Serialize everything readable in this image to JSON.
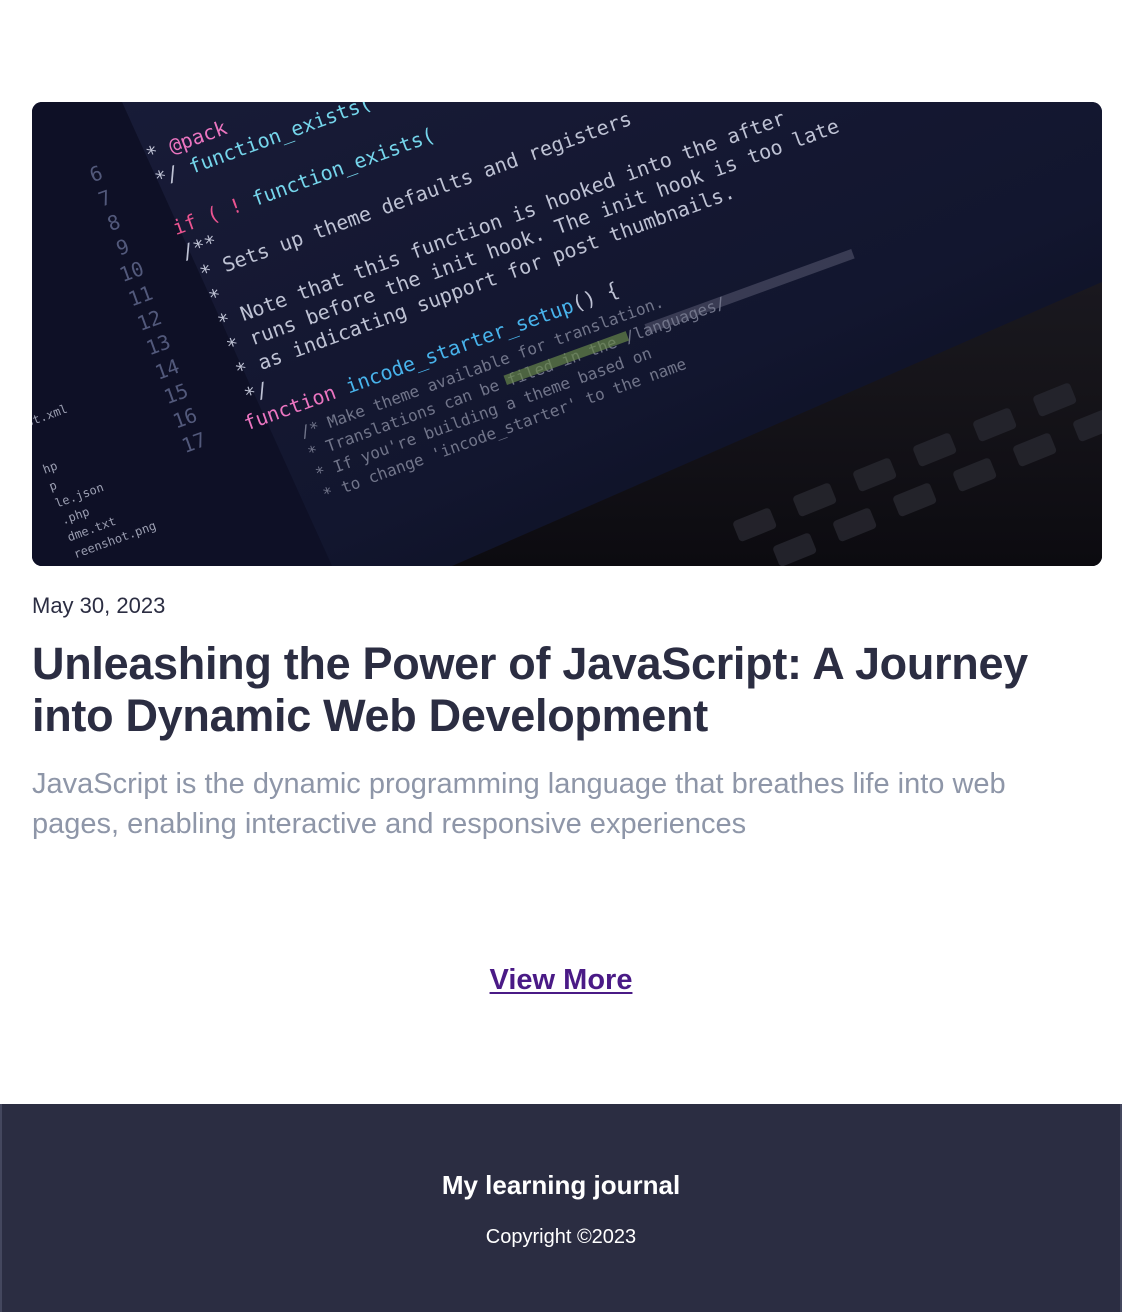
{
  "article": {
    "date": "May 30, 2023",
    "title": "Unleashing the Power of JavaScript: A Journey into Dynamic Web Development",
    "excerpt": "JavaScript is the dynamic programming language that breathes life into web pages, enabling interactive and responsive experiences"
  },
  "actions": {
    "view_more_label": "View More"
  },
  "footer": {
    "title": "My learning journal",
    "copyright": "Copyright ©2023"
  },
  "colors": {
    "text": "#2b2d42",
    "muted": "#8e96a8",
    "link": "#4a1a86",
    "footer_bg": "#2b2d42"
  }
}
